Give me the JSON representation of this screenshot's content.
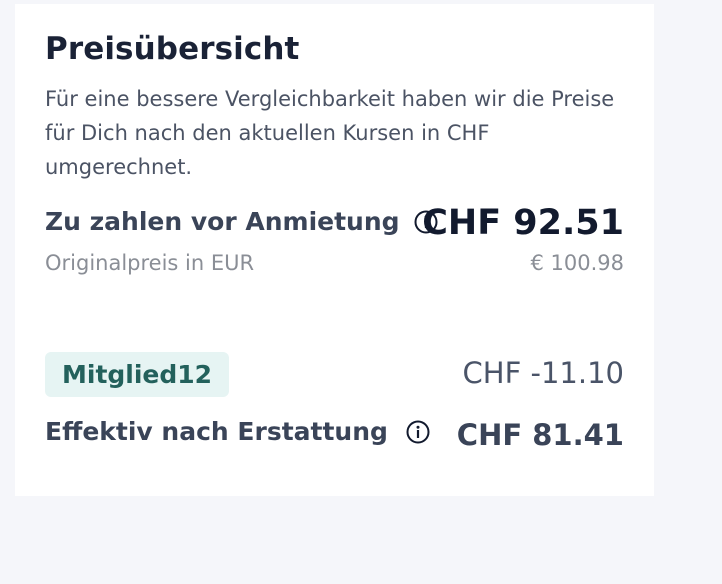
{
  "price_overview": {
    "title": "Preisübersicht",
    "description": "Für eine bessere Vergleichbarkeit haben wir die Preise für Dich nach den aktuellen Kursen in CHF umgerechnet.",
    "pay_before_rental": {
      "label": "Zu zahlen vor Anmietung",
      "info_icon": "info-circle-icon",
      "price": "CHF 92.51"
    },
    "original_price": {
      "label": "Originalpreis in EUR",
      "price": "€ 100.98"
    },
    "discount": {
      "code": "Mitglied12",
      "amount": "CHF -11.10"
    },
    "effective_after_refund": {
      "label": "Effektiv nach Erstattung",
      "info_icon": "info-circle-icon",
      "price": "CHF 81.41"
    }
  },
  "colors": {
    "page_background": "#f5f6fa",
    "card_background": "#ffffff",
    "badge_background": "#e6f4f3",
    "badge_text": "#23615c"
  }
}
